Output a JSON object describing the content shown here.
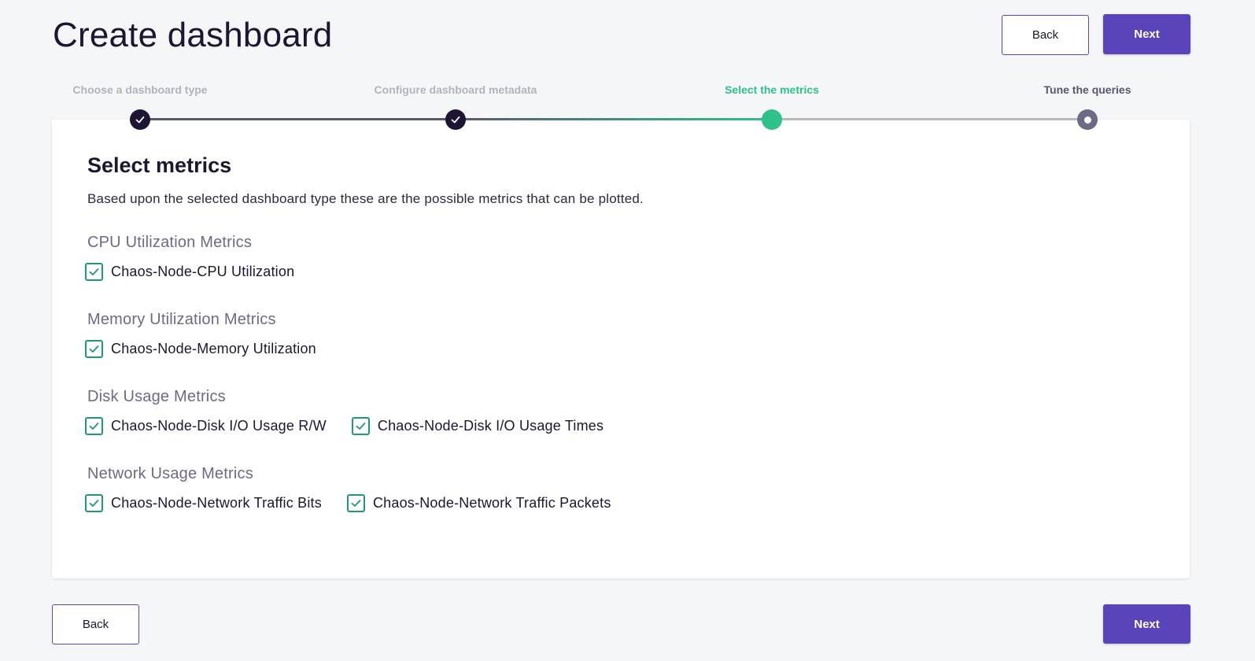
{
  "header": {
    "title": "Create dashboard",
    "back_label": "Back",
    "next_label": "Next"
  },
  "stepper": {
    "steps": [
      {
        "label": "Choose a dashboard type",
        "status": "done"
      },
      {
        "label": "Configure dashboard metadata",
        "status": "done"
      },
      {
        "label": "Select the metrics",
        "status": "active"
      },
      {
        "label": "Tune the queries",
        "status": "pending"
      }
    ]
  },
  "main": {
    "title": "Select metrics",
    "description": "Based upon the selected dashboard type these are the possible metrics that can be plotted.",
    "groups": [
      {
        "title": "CPU Utilization Metrics",
        "options": [
          {
            "label": "Chaos-Node-CPU Utilization",
            "checked": true
          }
        ]
      },
      {
        "title": "Memory Utilization Metrics",
        "options": [
          {
            "label": "Chaos-Node-Memory Utilization",
            "checked": true
          }
        ]
      },
      {
        "title": "Disk Usage Metrics",
        "options": [
          {
            "label": "Chaos-Node-Disk I/O Usage R/W",
            "checked": true
          },
          {
            "label": "Chaos-Node-Disk I/O Usage Times",
            "checked": true
          }
        ]
      },
      {
        "title": "Network Usage Metrics",
        "options": [
          {
            "label": "Chaos-Node-Network Traffic Bits",
            "checked": true
          },
          {
            "label": "Chaos-Node-Network Traffic Packets",
            "checked": true
          }
        ]
      }
    ]
  },
  "footer": {
    "back_label": "Back",
    "next_label": "Next"
  },
  "colors": {
    "primary": "#5b44ba",
    "success": "#2ec28a",
    "checkbox": "#1d9b6c",
    "done_step": "#1e1433",
    "pending_step": "#6c6a86"
  }
}
